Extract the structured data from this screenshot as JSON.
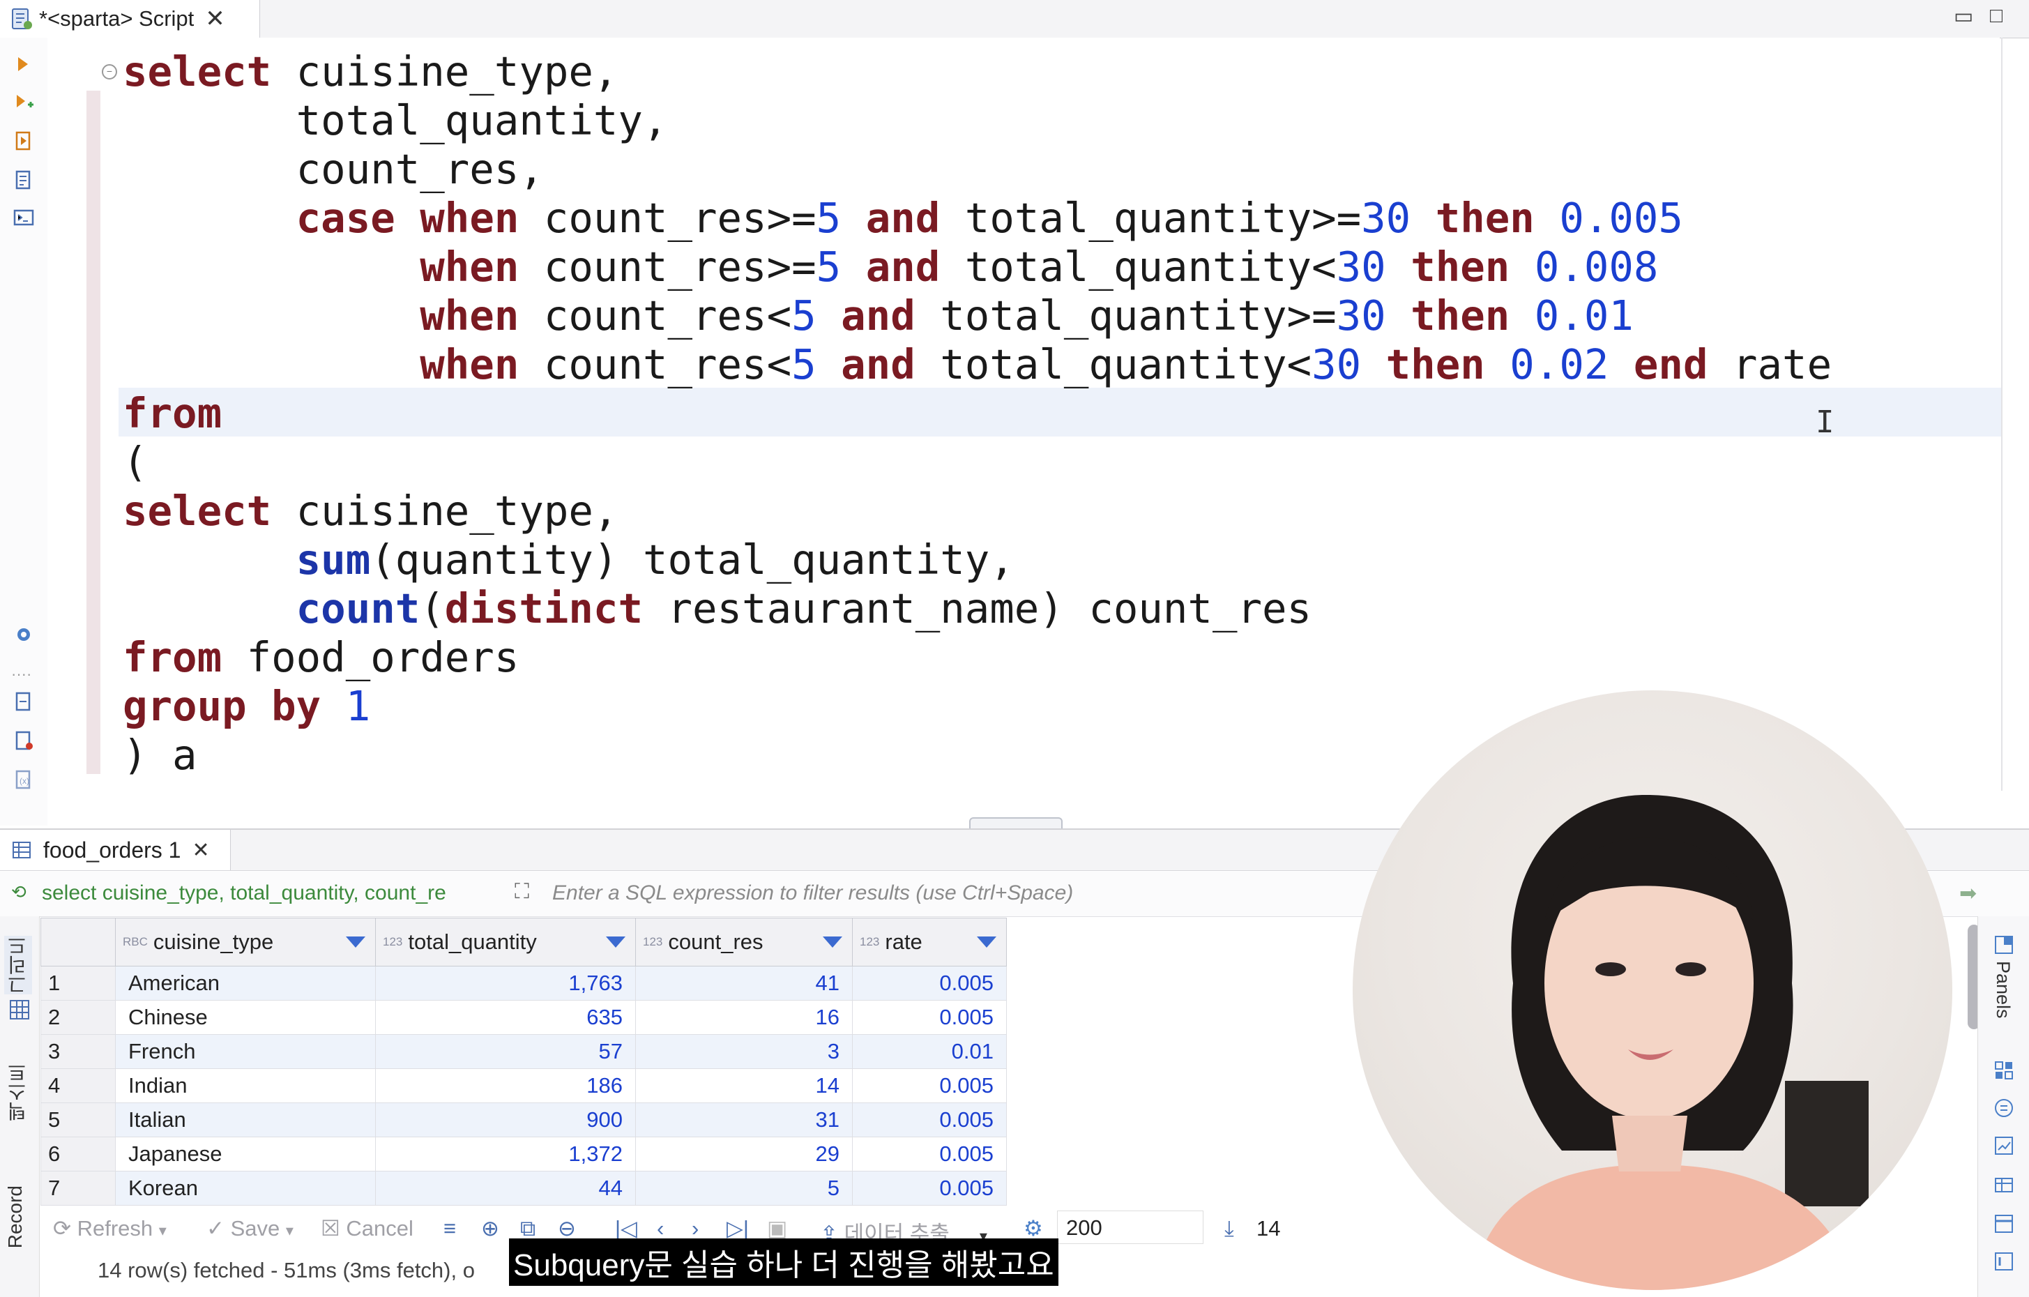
{
  "editor_tab": {
    "title": "*<sparta> Script"
  },
  "code_lines": [
    [
      {
        "t": "select",
        "c": "kw"
      },
      {
        "t": " cuisine_type,"
      }
    ],
    [
      {
        "t": "       total_quantity,"
      }
    ],
    [
      {
        "t": "       count_res,"
      }
    ],
    [
      {
        "t": "       "
      },
      {
        "t": "case",
        "c": "kw"
      },
      {
        "t": " "
      },
      {
        "t": "when",
        "c": "kw"
      },
      {
        "t": " count_res>="
      },
      {
        "t": "5",
        "c": "num"
      },
      {
        "t": " "
      },
      {
        "t": "and",
        "c": "kw"
      },
      {
        "t": " total_quantity>="
      },
      {
        "t": "30",
        "c": "num"
      },
      {
        "t": " "
      },
      {
        "t": "then",
        "c": "kw"
      },
      {
        "t": " "
      },
      {
        "t": "0.005",
        "c": "num"
      }
    ],
    [
      {
        "t": "            "
      },
      {
        "t": "when",
        "c": "kw"
      },
      {
        "t": " count_res>="
      },
      {
        "t": "5",
        "c": "num"
      },
      {
        "t": " "
      },
      {
        "t": "and",
        "c": "kw"
      },
      {
        "t": " total_quantity<"
      },
      {
        "t": "30",
        "c": "num"
      },
      {
        "t": " "
      },
      {
        "t": "then",
        "c": "kw"
      },
      {
        "t": " "
      },
      {
        "t": "0.008",
        "c": "num"
      }
    ],
    [
      {
        "t": "            "
      },
      {
        "t": "when",
        "c": "kw"
      },
      {
        "t": " count_res<"
      },
      {
        "t": "5",
        "c": "num"
      },
      {
        "t": " "
      },
      {
        "t": "and",
        "c": "kw"
      },
      {
        "t": " total_quantity>="
      },
      {
        "t": "30",
        "c": "num"
      },
      {
        "t": " "
      },
      {
        "t": "then",
        "c": "kw"
      },
      {
        "t": " "
      },
      {
        "t": "0.01",
        "c": "num"
      }
    ],
    [
      {
        "t": "            "
      },
      {
        "t": "when",
        "c": "kw"
      },
      {
        "t": " count_res<"
      },
      {
        "t": "5",
        "c": "num"
      },
      {
        "t": " "
      },
      {
        "t": "and",
        "c": "kw"
      },
      {
        "t": " total_quantity<"
      },
      {
        "t": "30",
        "c": "num"
      },
      {
        "t": " "
      },
      {
        "t": "then",
        "c": "kw"
      },
      {
        "t": " "
      },
      {
        "t": "0.02",
        "c": "num"
      },
      {
        "t": " "
      },
      {
        "t": "end",
        "c": "kw"
      },
      {
        "t": " rate"
      }
    ],
    [
      {
        "t": "from",
        "c": "kw"
      }
    ],
    [
      {
        "t": "("
      }
    ],
    [
      {
        "t": "select",
        "c": "kw"
      },
      {
        "t": " cuisine_type,"
      }
    ],
    [
      {
        "t": "       "
      },
      {
        "t": "sum",
        "c": "fn"
      },
      {
        "t": "(quantity) total_quantity,"
      }
    ],
    [
      {
        "t": "       "
      },
      {
        "t": "count",
        "c": "fn"
      },
      {
        "t": "("
      },
      {
        "t": "distinct",
        "c": "kw"
      },
      {
        "t": " restaurant_name) count_res"
      }
    ],
    [
      {
        "t": "from",
        "c": "kw"
      },
      {
        "t": " food_orders"
      }
    ],
    [
      {
        "t": "group",
        "c": "kw"
      },
      {
        "t": " "
      },
      {
        "t": "by",
        "c": "kw"
      },
      {
        "t": " "
      },
      {
        "t": "1",
        "c": "num"
      }
    ],
    [
      {
        "t": ") a"
      }
    ]
  ],
  "result_tab": {
    "title": "food_orders 1"
  },
  "filter": {
    "query_preview": "select cuisine_type, total_quantity, count_re",
    "placeholder": "Enter a SQL expression to filter results (use Ctrl+Space)"
  },
  "side_tabs": {
    "grid": "그리드",
    "text": "텍스트",
    "record": "Record"
  },
  "table": {
    "columns": [
      {
        "badge": "RBC",
        "name": "cuisine_type"
      },
      {
        "badge": "123",
        "name": "total_quantity"
      },
      {
        "badge": "123",
        "name": "count_res"
      },
      {
        "badge": "123",
        "name": "rate"
      }
    ],
    "rows": [
      [
        "1",
        "American",
        "1,763",
        "41",
        "0.005"
      ],
      [
        "2",
        "Chinese",
        "635",
        "16",
        "0.005"
      ],
      [
        "3",
        "French",
        "57",
        "3",
        "0.01"
      ],
      [
        "4",
        "Indian",
        "186",
        "14",
        "0.005"
      ],
      [
        "5",
        "Italian",
        "900",
        "31",
        "0.005"
      ],
      [
        "6",
        "Japanese",
        "1,372",
        "29",
        "0.005"
      ],
      [
        "7",
        "Korean",
        "44",
        "5",
        "0.005"
      ]
    ]
  },
  "bottom_toolbar": {
    "refresh": "Refresh",
    "save": "Save",
    "cancel": "Cancel",
    "export": "데이터 추출 ...",
    "fetch_size": "200",
    "row_count": "14"
  },
  "status": {
    "text": "14 row(s) fetched - 51ms (3ms fetch), o"
  },
  "right_panel": {
    "label": "Panels"
  },
  "subtitle": {
    "text": "Subquery문 실습 하나 더 진행을 해봤고요"
  },
  "colors": {
    "keyword": "#7a1a22",
    "function": "#1c35a8",
    "number": "#1a3fd0",
    "query_green": "#3c8a3c",
    "row_alt": "#eef3fb"
  }
}
